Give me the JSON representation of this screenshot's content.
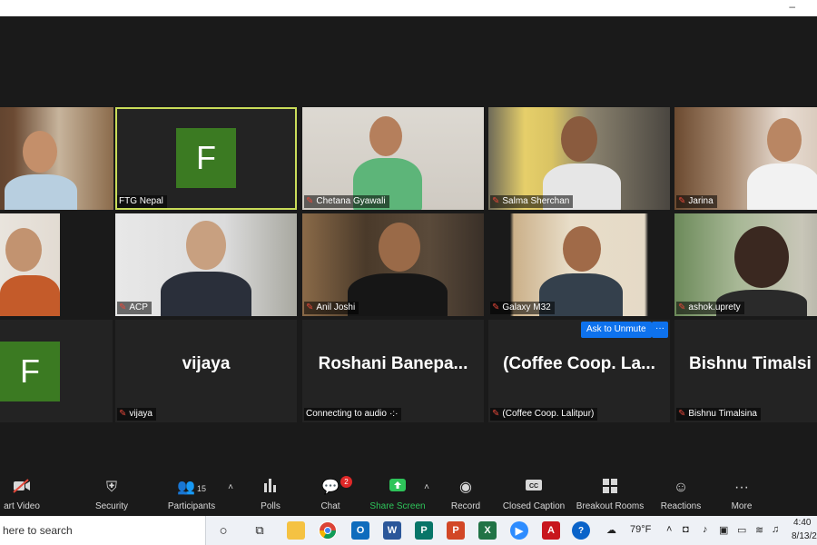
{
  "tiles": [
    {
      "label": ""
    },
    {
      "label": "FTG Nepal",
      "avatar": "F"
    },
    {
      "label": "Chetana Gyawali"
    },
    {
      "label": "Salma Sherchan"
    },
    {
      "label": "Jarina"
    },
    {
      "label": ""
    },
    {
      "label": "ACP"
    },
    {
      "label": "Anil Joshi"
    },
    {
      "label": "Galaxy M32"
    },
    {
      "label": "ashok.uprety"
    },
    {
      "label": "",
      "avatar": "F"
    },
    {
      "label": "vijaya",
      "big": "vijaya"
    },
    {
      "label": "Connecting to audio",
      "big": "Roshani   Banepa..."
    },
    {
      "label": "(Coffee Coop. Lalitpur)",
      "big": "(Coffee  Coop.  La..."
    },
    {
      "label": "Bishnu Timalsina",
      "big": "Bishnu  Timalsi"
    }
  ],
  "ask_to_unmute": "Ask to Unmute",
  "ask_more": "···",
  "toolbar": {
    "start_video": "art Video",
    "security": "Security",
    "participants": "Participants",
    "participants_count": "15",
    "polls": "Polls",
    "chat": "Chat",
    "chat_badge": "2",
    "share_screen": "Share Screen",
    "record": "Record",
    "closed_caption": "Closed Caption",
    "breakout_rooms": "Breakout Rooms",
    "reactions": "Reactions",
    "more": "More"
  },
  "taskbar": {
    "search_placeholder": "here to search",
    "weather": "79°F",
    "time": "4:40",
    "date": "8/13/2"
  },
  "colors": {
    "speaker_highlight": "#c9dc59",
    "avatar_green": "#3b7a22",
    "share_green": "#2ec45a",
    "unmute_blue": "#0e72ed",
    "mic_muted_red": "#e5483a"
  }
}
